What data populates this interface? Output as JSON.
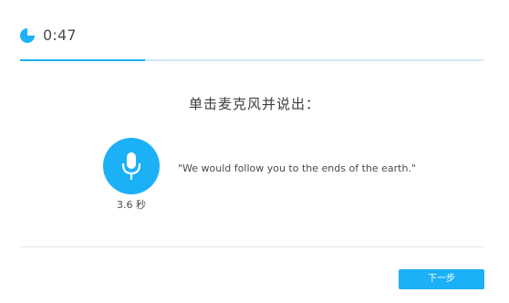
{
  "header": {
    "timer_icon": "pie-timer-icon",
    "timer_text": "0:47",
    "progress_fraction": 0.27
  },
  "exercise": {
    "prompt": "单击麦克风并说出：",
    "mic_icon": "microphone-icon",
    "duration": "3.6 秒",
    "sentence": "\"We would follow you to the ends of the earth.\""
  },
  "footer": {
    "next_label": "下一步"
  },
  "colors": {
    "accent": "#1cb0f6",
    "track": "#cfe9f7",
    "text": "#4b4b4b",
    "divider": "#e5e5e5"
  }
}
